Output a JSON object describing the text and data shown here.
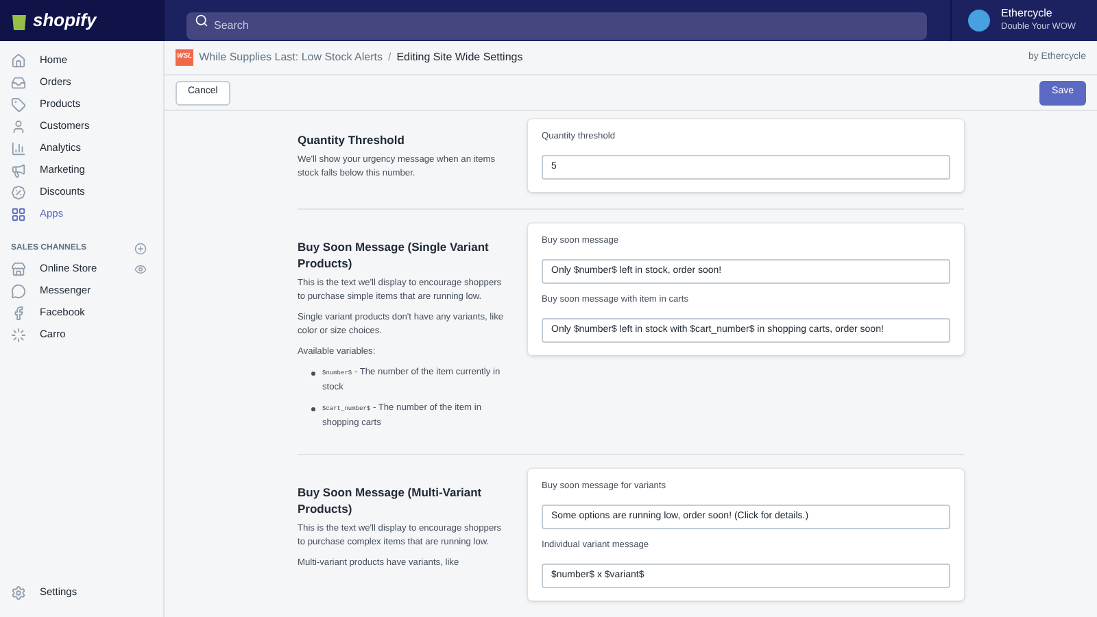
{
  "topbar": {
    "logo": "shopify",
    "search": {
      "placeholder": "Search"
    },
    "store": {
      "name": "Ethercycle",
      "tagline": "Double Your WOW"
    }
  },
  "sidebar": {
    "items": [
      {
        "label": "Home",
        "selected": false
      },
      {
        "label": "Orders",
        "selected": false
      },
      {
        "label": "Products",
        "selected": false
      },
      {
        "label": "Customers",
        "selected": false
      },
      {
        "label": "Analytics",
        "selected": false
      },
      {
        "label": "Marketing",
        "selected": false
      },
      {
        "label": "Discounts",
        "selected": false
      },
      {
        "label": "Apps",
        "selected": true
      }
    ],
    "channels_heading": "SALES CHANNELS",
    "channels": [
      {
        "label": "Online Store"
      },
      {
        "label": "Messenger"
      },
      {
        "label": "Facebook"
      },
      {
        "label": "Carro"
      }
    ],
    "settings": "Settings"
  },
  "header": {
    "app_name": "While Supplies Last: Low Stock Alerts",
    "separator": "/",
    "page": "Editing Site Wide Settings",
    "author": "by Ethercycle",
    "app_icon_text": "WSL"
  },
  "toolbar": {
    "cancel": "Cancel",
    "save": "Save"
  },
  "sections": [
    {
      "title": "Quantity Threshold",
      "paragraphs": [
        "We'll show your urgency message when an items stock falls below this number."
      ],
      "fields": [
        {
          "label": "Quantity threshold",
          "value": "5"
        }
      ]
    },
    {
      "title": "Buy Soon Message (Single Variant Products)",
      "paragraphs": [
        "This is the text we'll display to encourage shoppers to purchase simple items that are running low.",
        "Single variant products don't have any variants, like color or size choices.",
        "Available variables:"
      ],
      "variables": [
        {
          "code": "$number$",
          "text": "- The number of the item currently in stock"
        },
        {
          "code": "$cart_number$",
          "text": "- The number of the item in shopping carts"
        }
      ],
      "fields": [
        {
          "label": "Buy soon message",
          "value": "Only $number$ left in stock, order soon!"
        },
        {
          "label": "Buy soon message with item in carts",
          "value": "Only $number$ left in stock with $cart_number$ in shopping carts, order soon!"
        }
      ]
    },
    {
      "title": "Buy Soon Message (Multi-Variant Products)",
      "paragraphs": [
        "This is the text we'll display to encourage shoppers to purchase complex items that are running low.",
        "Multi-variant products have variants, like"
      ],
      "fields": [
        {
          "label": "Buy soon message for variants",
          "value": "Some options are running low, order soon! (Click for details.)"
        },
        {
          "label": "Individual variant message",
          "value": "$number$ x $variant$"
        }
      ]
    }
  ]
}
